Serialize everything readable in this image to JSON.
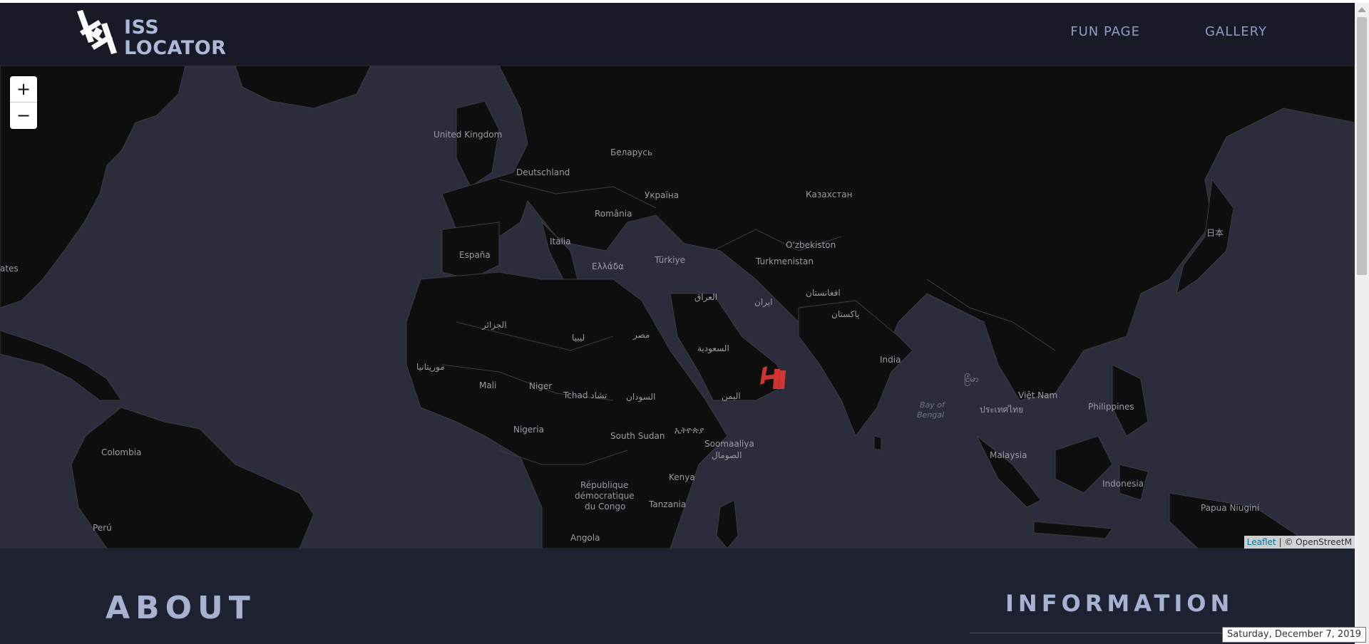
{
  "header": {
    "logo_line1": "ISS",
    "logo_line2": "LOCATOR",
    "nav": {
      "fun_page": "FUN PAGE",
      "gallery": "GALLERY"
    }
  },
  "map": {
    "zoom_in": "+",
    "zoom_out": "−",
    "labels": [
      "ates",
      "United Kingdom",
      "Deutschland",
      "Беларусь",
      "Україна",
      "România",
      "Italia",
      "España",
      "Ελλάδα",
      "Türkiye",
      "Казахстан",
      "O'zbekiston",
      "Turkmenistan",
      "日本",
      "العراق",
      "ایران",
      "افغانستان",
      "پاکستان",
      "الجزائر",
      "ليبيا",
      "مصر",
      "السعودية",
      "موريتانيا",
      "Mali",
      "Niger",
      "Tchad تشاد",
      "السودان",
      "اليمن",
      "India",
      "Bay of",
      "Bengal",
      "Việt Nam",
      "ประเทศไทย",
      "Philippines",
      "Nigeria",
      "South Sudan",
      "ኢትዮጵያ",
      "Soomaaliya",
      "الصومال",
      "Colombia",
      "République",
      "démocratique",
      "du Congo",
      "Kenya",
      "Tanzania",
      "Malaysia",
      "Indonesia",
      "Papua Niugini",
      "Perú",
      "Angola",
      "ငြံမာ"
    ],
    "attribution_link": "Leaflet",
    "attribution_rest": " | © OpenStreetM",
    "marker_icon": "iss-marker-icon",
    "colors": {
      "ocean": "#2b2d3d",
      "land": "#0e0e0f",
      "borders": "#3d3a40",
      "marker": "#e53935"
    }
  },
  "about": {
    "title": "ABOUT"
  },
  "information": {
    "title": "INFORMATION"
  },
  "tooltip": "Saturday, December 7, 2019"
}
